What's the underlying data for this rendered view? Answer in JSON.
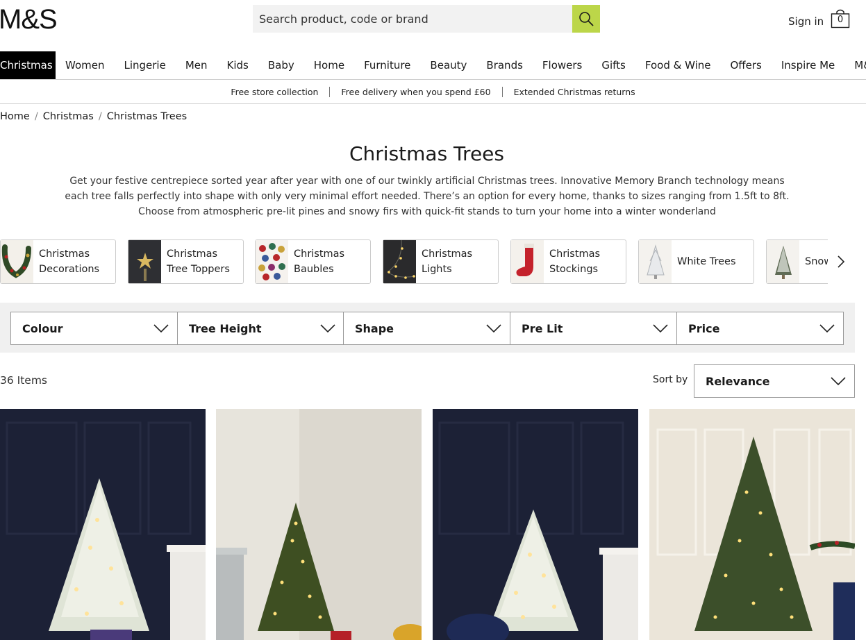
{
  "brand": {
    "logo": "M&S"
  },
  "search": {
    "placeholder": "Search product, code or brand"
  },
  "account": {
    "signin": "Sign in",
    "bag_count": "0"
  },
  "nav": {
    "items": [
      "Christmas",
      "Women",
      "Lingerie",
      "Men",
      "Kids",
      "Baby",
      "Home",
      "Furniture",
      "Beauty",
      "Brands",
      "Flowers",
      "Gifts",
      "Food & Wine",
      "Offers",
      "Inspire Me",
      "M&S Bank"
    ],
    "active": "Christmas"
  },
  "promo": [
    "Free store collection",
    "Free delivery when you spend £60",
    "Extended Christmas returns"
  ],
  "breadcrumb": [
    "Home",
    "Christmas",
    "Christmas Trees"
  ],
  "page": {
    "title": "Christmas Trees",
    "description": "Get your festive centrepiece sorted year after year with one of our twinkly artificial Christmas trees. Innovative Memory Branch technology means each tree falls perfectly into shape with only very minimal effort needed. There’s an option for every home, thanks to sizes ranging from 1.5ft to 8ft. Choose from atmospheric pre-lit pines and snowy firs with quick-fit stands to turn your home into a winter wonderland"
  },
  "categories": [
    {
      "line1": "Christmas",
      "line2": "Decorations",
      "icon": "garland-icon"
    },
    {
      "line1": "Christmas",
      "line2": "Tree Toppers",
      "icon": "star-topper-icon"
    },
    {
      "line1": "Christmas",
      "line2": "Baubles",
      "icon": "baubles-icon"
    },
    {
      "line1": "Christmas",
      "line2": "Lights",
      "icon": "fairy-lights-icon"
    },
    {
      "line1": "Christmas",
      "line2": "Stockings",
      "icon": "stocking-icon"
    },
    {
      "line1": "White Trees",
      "line2": "",
      "icon": "white-tree-icon"
    },
    {
      "line1": "Snow",
      "line2": "",
      "icon": "snowy-tree-icon"
    }
  ],
  "filters": [
    "Colour",
    "Tree Height",
    "Shape",
    "Pre Lit",
    "Price"
  ],
  "results": {
    "count": "36 Items",
    "sort_label": "Sort by",
    "sort_value": "Relevance"
  },
  "colors": {
    "accent": "#bcd649",
    "nav_active_bg": "#000000",
    "filter_bg": "#f0f0f0"
  },
  "products": [
    {
      "image": "snowy-prelit-tree-dark-room"
    },
    {
      "image": "green-prelit-tree-light-room"
    },
    {
      "image": "snowy-prelit-tree-dark-room-2"
    },
    {
      "image": "green-prelit-tree-panelled-room"
    }
  ]
}
